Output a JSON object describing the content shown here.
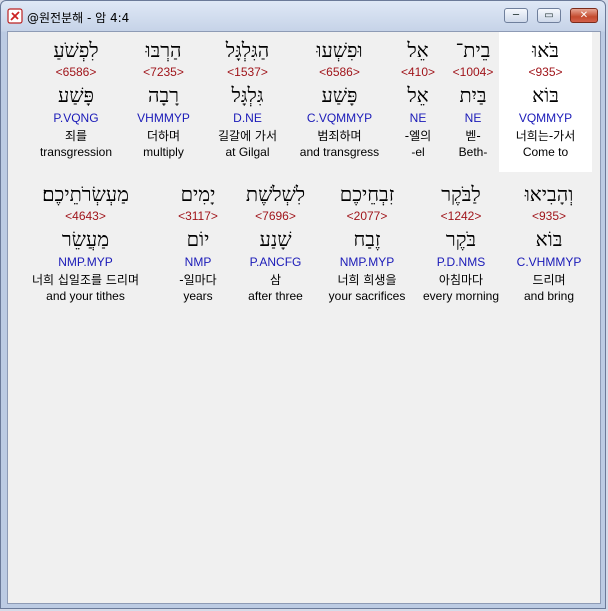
{
  "window": {
    "title": "@원전분해 - 암 4:4"
  },
  "controls": {
    "minimize": "─",
    "maximize": "▭",
    "close": "✕"
  },
  "row1": [
    {
      "surface": "בֹּאוּ",
      "strong": "<935>",
      "lemma": "בּוֹא",
      "morph": "VQMMYP",
      "korean": "너희는-가서",
      "english": "Come to",
      "highlighted": true
    },
    {
      "surface": "בֵית־",
      "strong": "<1004>",
      "lemma": "בַּיִת",
      "morph": "NE",
      "korean": "벧-",
      "english": "Beth-"
    },
    {
      "surface": "אֵל",
      "strong": "<410>",
      "lemma": "אֵל",
      "morph": "NE",
      "korean": "-엘의",
      "english": "-el"
    },
    {
      "surface": "וּפִשְׁעוּ",
      "strong": "<6586>",
      "lemma": "פָּשַׁע",
      "morph": "C.VQMMYP",
      "korean": "범죄하며",
      "english": "and transgress"
    },
    {
      "surface": "הַגִּלְגָּל",
      "strong": "<1537>",
      "lemma": "גִּלְגָּל",
      "morph": "D.NE",
      "korean": "길갈에 가서",
      "english": "at Gilgal"
    },
    {
      "surface": "הַרְבּוּ",
      "strong": "<7235>",
      "lemma": "רָבָה",
      "morph": "VHMMYP",
      "korean": "더하며",
      "english": "multiply"
    },
    {
      "surface": "לִפְשֹׁעַ",
      "strong": "<6586>",
      "lemma": "פָּשַׁע",
      "morph": "P.VQNG",
      "korean": "죄를",
      "english": "transgression"
    }
  ],
  "row2": [
    {
      "surface": "וְהָבִיאוּ",
      "strong": "<935>",
      "lemma": "בּוֹא",
      "morph": "C.VHMMYP",
      "korean": "드리며",
      "english": "and bring"
    },
    {
      "surface": "לַבֹּקֶר",
      "strong": "<1242>",
      "lemma": "בֹּקֶר",
      "morph": "P.D.NMS",
      "korean": "아침마다",
      "english": "every morning"
    },
    {
      "surface": "זִבְחֵיכֶם",
      "strong": "<2077>",
      "lemma": "זֶבַח",
      "morph": "NMP.MYP",
      "korean": "너희 희생을",
      "english": "your sacrifices"
    },
    {
      "surface": "לִשְׁלֹשֶׁת",
      "strong": "<7696>",
      "lemma": "שָׁנַע",
      "morph": "P.ANCFG",
      "korean": "삼",
      "english": "after three"
    },
    {
      "surface": "יָמִים",
      "strong": "<3117>",
      "lemma": "יוֹם",
      "morph": "NMP",
      "korean": "-일마다",
      "english": "years"
    },
    {
      "surface": "מַעְשְׂרֹתֵיכֶם׃",
      "strong": "<4643>",
      "lemma": "מַעֲשֵׂר",
      "morph": "NMP.MYP",
      "korean": "너희 십일조를 드리며",
      "english": "and your tithes"
    }
  ]
}
